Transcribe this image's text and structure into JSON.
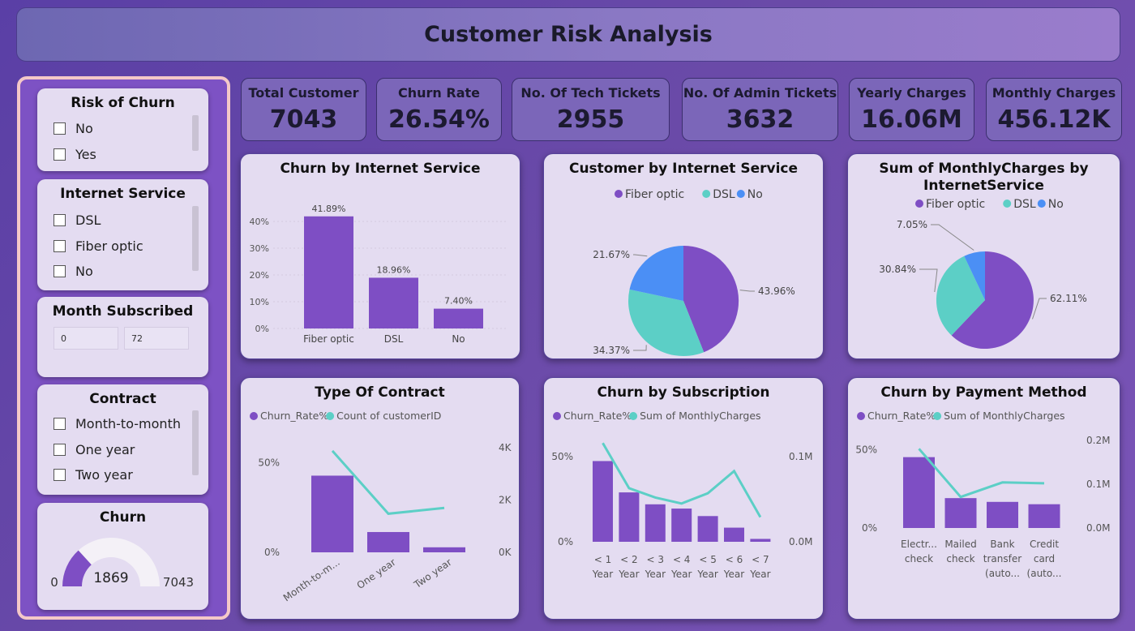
{
  "header": {
    "title": "Customer Risk Analysis"
  },
  "slicers": {
    "risk": {
      "title": "Risk of Churn",
      "options": [
        "No",
        "Yes"
      ]
    },
    "internet": {
      "title": "Internet Service",
      "options": [
        "DSL",
        "Fiber optic",
        "No"
      ]
    },
    "month": {
      "title": "Month Subscribed",
      "min": "0",
      "max": "72"
    },
    "contract": {
      "title": "Contract",
      "options": [
        "Month-to-month",
        "One year",
        "Two year"
      ]
    },
    "churn": {
      "title": "Churn",
      "min": "0",
      "max": "7043",
      "value": "1869",
      "fraction": 0.2654
    }
  },
  "kpis": [
    {
      "label": "Total Customer",
      "value": "7043"
    },
    {
      "label": "Churn Rate",
      "value": "26.54%"
    },
    {
      "label": "No. Of Tech Tickets",
      "value": "2955"
    },
    {
      "label": "No. Of Admin Tickets",
      "value": "3632"
    },
    {
      "label": "Yearly Charges",
      "value": "16.06M"
    },
    {
      "label": "Monthly Charges",
      "value": "456.12K"
    }
  ],
  "colors": {
    "purple": "#7e4ec4",
    "teal": "#5ccfc6",
    "blue": "#4b8ff5"
  },
  "chart_data": [
    {
      "id": "churn_internet",
      "type": "bar",
      "title": "Churn by Internet Service",
      "categories": [
        "Fiber optic",
        "DSL",
        "No"
      ],
      "values": [
        41.89,
        18.96,
        7.4
      ],
      "labels": [
        "41.89%",
        "18.96%",
        "7.40%"
      ],
      "yticks": [
        "0%",
        "10%",
        "20%",
        "30%",
        "40%"
      ],
      "ylim": [
        0,
        50
      ]
    },
    {
      "id": "customer_internet",
      "type": "pie",
      "title": "Customer by Internet Service",
      "legend": [
        "Fiber optic",
        "DSL",
        "No"
      ],
      "values": [
        43.96,
        34.37,
        21.67
      ],
      "labels": [
        "43.96%",
        "34.37%",
        "21.67%"
      ]
    },
    {
      "id": "monthly_internet",
      "type": "pie",
      "title_line1": "Sum of MonthlyCharges by",
      "title_line2": "InternetService",
      "legend": [
        "Fiber optic",
        "DSL",
        "No"
      ],
      "values": [
        62.11,
        30.84,
        7.05
      ],
      "labels": [
        "62.11%",
        "30.84%",
        "7.05%"
      ]
    },
    {
      "id": "contract",
      "type": "bar",
      "title": "Type Of Contract",
      "legend": [
        "Churn_Rate%",
        "Count of customerID"
      ],
      "categories": [
        "Month-to-m...",
        "One year",
        "Two year"
      ],
      "bars": [
        42.7,
        11.3,
        2.8
      ],
      "line": [
        3875,
        1473,
        1695
      ],
      "yticks_left": [
        "0%",
        "50%"
      ],
      "yticks_right": [
        "0K",
        "2K",
        "4K"
      ],
      "ylim_left": [
        0,
        70
      ],
      "ylim_right": [
        0,
        4800
      ]
    },
    {
      "id": "subscription",
      "type": "bar",
      "title": "Churn by Subscription",
      "legend": [
        "Churn_Rate%",
        "Sum of MonthlyCharges"
      ],
      "categories": [
        "< 1",
        "< 2",
        "< 3",
        "< 4",
        "< 5",
        "< 6",
        "< 7"
      ],
      "categories2": [
        "Year",
        "Year",
        "Year",
        "Year",
        "Year",
        "Year",
        "Year"
      ],
      "bars": [
        47.4,
        29.0,
        22.0,
        19.5,
        15.1,
        8.3,
        1.7
      ],
      "line": [
        0.116,
        0.063,
        0.052,
        0.045,
        0.057,
        0.083,
        0.029
      ],
      "yticks_left": [
        "0%",
        "50%"
      ],
      "yticks_right": [
        "0.0M",
        "0.1M"
      ],
      "ylim_left": [
        0,
        70
      ],
      "ylim_right": [
        0,
        0.14
      ]
    },
    {
      "id": "payment",
      "type": "bar",
      "title": "Churn by Payment Method",
      "legend": [
        "Churn_Rate%",
        "Sum of MonthlyCharges"
      ],
      "categories": [
        [
          "Electr...",
          "check"
        ],
        [
          "Mailed",
          "check"
        ],
        [
          "Bank",
          "transfer",
          "(auto..."
        ],
        [
          "Credit",
          "card",
          "(auto..."
        ]
      ],
      "bars": [
        45.3,
        19.1,
        16.7,
        15.2
      ],
      "line": [
        0.181,
        0.071,
        0.104,
        0.102
      ],
      "yticks_left": [
        "0%",
        "50%"
      ],
      "yticks_right": [
        "0.0M",
        "0.1M",
        "0.2M"
      ],
      "ylim_left": [
        0,
        70
      ],
      "ylim_right": [
        0,
        0.25
      ]
    }
  ]
}
